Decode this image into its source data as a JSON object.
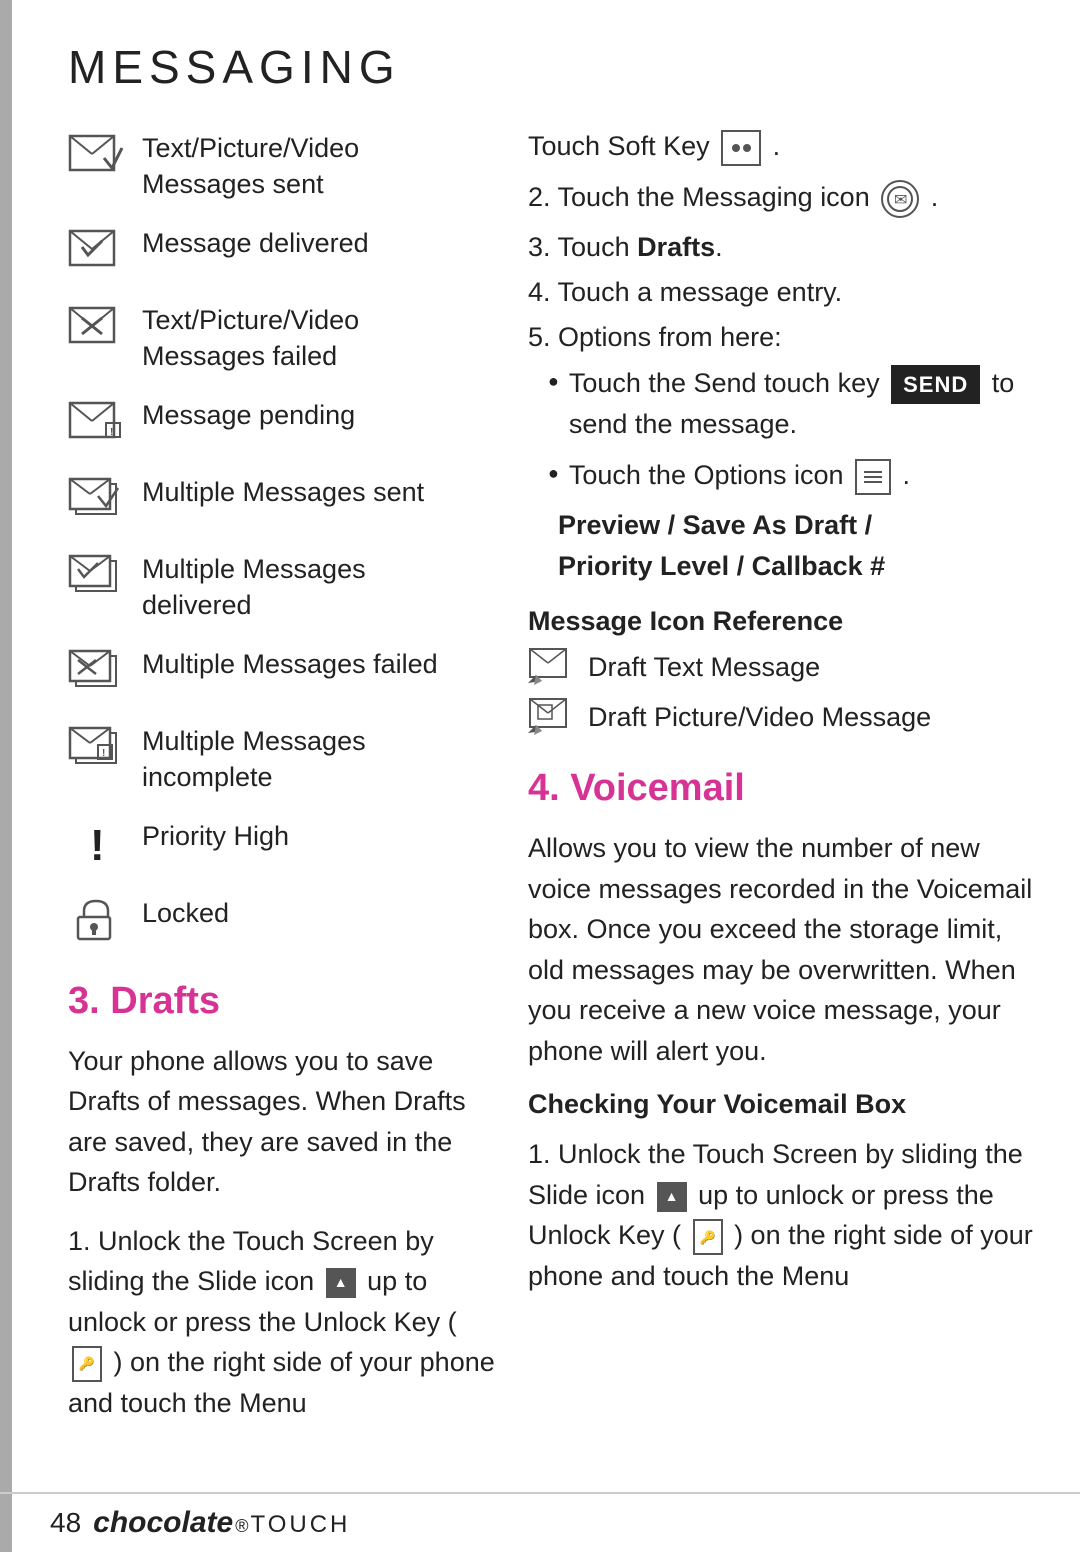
{
  "page": {
    "title": "MESSAGING",
    "footer": {
      "page_number": "48",
      "brand": "chocolate",
      "brand_touch": "TOUCH"
    }
  },
  "icon_list": [
    {
      "id": "sent",
      "label": "Text/Picture/Video\nMessages sent"
    },
    {
      "id": "delivered",
      "label": "Message delivered"
    },
    {
      "id": "failed",
      "label": "Text/Picture/Video\nMessages failed"
    },
    {
      "id": "pending",
      "label": "Message pending"
    },
    {
      "id": "multi-sent",
      "label": "Multiple Messages sent"
    },
    {
      "id": "multi-delivered",
      "label": "Multiple Messages\ndelivered"
    },
    {
      "id": "multi-failed",
      "label": "Multiple Messages failed"
    },
    {
      "id": "multi-incomplete",
      "label": "Multiple Messages\nincomplete"
    },
    {
      "id": "priority",
      "label": "Priority High"
    },
    {
      "id": "locked",
      "label": "Locked"
    }
  ],
  "drafts": {
    "heading": "3. Drafts",
    "body": "Your phone allows you to save Drafts of messages. When Drafts are saved, they are saved in the Drafts folder.",
    "steps": [
      {
        "num": "1.",
        "text": "Unlock the Touch Screen by sliding the Slide icon"
      },
      {
        "num": "",
        "text": "up to unlock or press the Unlock Key ( ) on the right side of your phone and touch the Menu"
      }
    ]
  },
  "right_col": {
    "intro": "Touch Soft Key",
    "step2": "2. Touch the Messaging icon",
    "step3": "3. Touch Drafts.",
    "step4": "4. Touch a message entry.",
    "step5": "5. Options from here:",
    "bullet1": "Touch the Send touch key",
    "send_label": "SEND",
    "bullet1_end": "to send the message.",
    "bullet2": "Touch the Options icon",
    "options_submenu": "Preview / Save As Draft /\nPriority Level / Callback #",
    "msg_ref_heading": "Message Icon Reference",
    "msg_ref_items": [
      "Draft Text Message",
      "Draft Picture/Video Message"
    ]
  },
  "voicemail": {
    "heading": "4. Voicemail",
    "body": "Allows you to view the number of new voice messages recorded in the Voicemail box. Once you exceed the storage limit, old messages may be overwritten. When you receive a new voice message, your phone will alert you.",
    "checking_heading": "Checking Your Voicemail Box",
    "step1": "1. Unlock the Touch Screen by sliding the Slide icon",
    "step1_cont": "up to unlock or press the Unlock Key ( ) on the right side of your phone and touch the Menu"
  }
}
